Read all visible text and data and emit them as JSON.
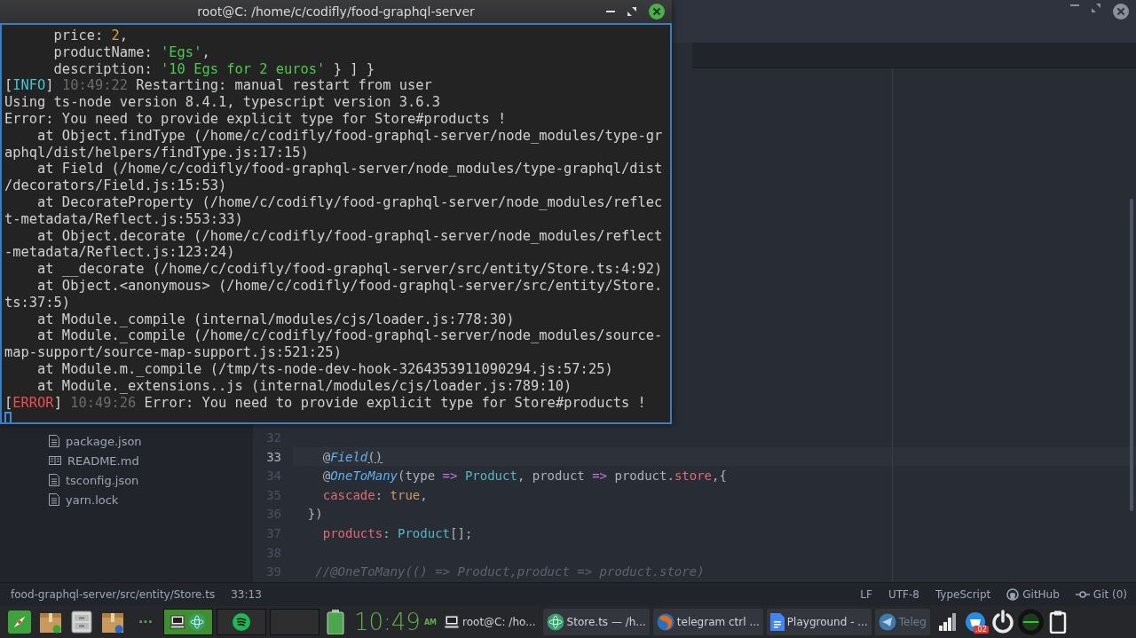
{
  "editor": {
    "sidebar": {
      "files": [
        {
          "name": "package.json",
          "kind": "file"
        },
        {
          "name": "README.md",
          "kind": "book"
        },
        {
          "name": "tsconfig.json",
          "kind": "file"
        },
        {
          "name": "yarn.lock",
          "kind": "file"
        }
      ]
    },
    "code": {
      "lines": [
        {
          "number": "32",
          "selected": false
        },
        {
          "number": "33",
          "selected": true,
          "tokens": [
            {
              "text": "    @",
              "kind": "plain"
            },
            {
              "text": "Field",
              "kind": "decorator"
            },
            {
              "text": "()",
              "kind": "match"
            }
          ]
        },
        {
          "number": "34",
          "selected": false,
          "tokens": [
            {
              "text": "    @",
              "kind": "plain"
            },
            {
              "text": "OneToMany",
              "kind": "decorator"
            },
            {
              "text": "(type ",
              "kind": "plain"
            },
            {
              "text": "=>",
              "kind": "operator"
            },
            {
              "text": " Product",
              "kind": "type"
            },
            {
              "text": ", product ",
              "kind": "plain"
            },
            {
              "text": "=>",
              "kind": "operator"
            },
            {
              "text": " product.",
              "kind": "plain"
            },
            {
              "text": "store",
              "kind": "property"
            },
            {
              "text": ",{",
              "kind": "plain"
            }
          ]
        },
        {
          "number": "35",
          "selected": false,
          "tokens": [
            {
              "text": "    cascade",
              "kind": "property"
            },
            {
              "text": ": ",
              "kind": "plain"
            },
            {
              "text": "true",
              "kind": "value"
            },
            {
              "text": ",",
              "kind": "plain"
            }
          ]
        },
        {
          "number": "36",
          "selected": false,
          "tokens": [
            {
              "text": "  })",
              "kind": "plain"
            }
          ]
        },
        {
          "number": "37",
          "selected": false,
          "tokens": [
            {
              "text": "    products",
              "kind": "property"
            },
            {
              "text": ": ",
              "kind": "plain"
            },
            {
              "text": "Product",
              "kind": "type"
            },
            {
              "text": "[];",
              "kind": "plain"
            }
          ]
        },
        {
          "number": "38",
          "selected": false
        },
        {
          "number": "39",
          "selected": false,
          "tokens": [
            {
              "text": "   //@OneToMany(() => Product,product => product.store)",
              "kind": "comment"
            }
          ]
        }
      ]
    },
    "status_bar": {
      "path": "food-graphql-server/src/entity/Store.ts",
      "position": "33:13",
      "items": [
        {
          "label": "LF",
          "kind": "text"
        },
        {
          "label": "UTF-8",
          "kind": "text"
        },
        {
          "label": "TypeScript",
          "kind": "text"
        },
        {
          "label": "GitHub",
          "kind": "github"
        },
        {
          "label": "Git (0)",
          "kind": "git"
        }
      ]
    }
  },
  "terminal": {
    "title": "root@C: /home/c/codifly/food-graphql-server",
    "lines": [
      [
        {
          "text": "      price: ",
          "kind": "plain"
        },
        {
          "text": "2",
          "kind": "number"
        },
        {
          "text": ",",
          "kind": "plain"
        }
      ],
      [
        {
          "text": "      productName: ",
          "kind": "plain"
        },
        {
          "text": "'Egs'",
          "kind": "string"
        },
        {
          "text": ",",
          "kind": "plain"
        }
      ],
      [
        {
          "text": "      description: ",
          "kind": "plain"
        },
        {
          "text": "'10 Egs for 2 euros'",
          "kind": "string"
        },
        {
          "text": " } ] }",
          "kind": "plain"
        }
      ],
      [
        {
          "text": "[",
          "kind": "plain"
        },
        {
          "text": "INFO",
          "kind": "info"
        },
        {
          "text": "] ",
          "kind": "plain"
        },
        {
          "text": "10:49:22",
          "kind": "time"
        },
        {
          "text": " Restarting: manual restart from user",
          "kind": "plain"
        }
      ],
      [
        {
          "text": "Using ts-node version 8.4.1, typescript version 3.6.3",
          "kind": "plain"
        }
      ],
      [
        {
          "text": "Error: You need to provide explicit type for Store#products !",
          "kind": "plain"
        }
      ],
      [
        {
          "text": "    at Object.findType (/home/c/codifly/food-graphql-server/node_modules/type-gr",
          "kind": "plain"
        }
      ],
      [
        {
          "text": "aphql/dist/helpers/findType.js:17:15)",
          "kind": "plain"
        }
      ],
      [
        {
          "text": "    at Field (/home/c/codifly/food-graphql-server/node_modules/type-graphql/dist",
          "kind": "plain"
        }
      ],
      [
        {
          "text": "/decorators/Field.js:15:53)",
          "kind": "plain"
        }
      ],
      [
        {
          "text": "    at DecorateProperty (/home/c/codifly/food-graphql-server/node_modules/reflec",
          "kind": "plain"
        }
      ],
      [
        {
          "text": "t-metadata/Reflect.js:553:33)",
          "kind": "plain"
        }
      ],
      [
        {
          "text": "    at Object.decorate (/home/c/codifly/food-graphql-server/node_modules/reflect",
          "kind": "plain"
        }
      ],
      [
        {
          "text": "-metadata/Reflect.js:123:24)",
          "kind": "plain"
        }
      ],
      [
        {
          "text": "    at __decorate (/home/c/codifly/food-graphql-server/src/entity/Store.ts:4:92)",
          "kind": "plain"
        }
      ],
      [
        {
          "text": "    at Object.<anonymous> (/home/c/codifly/food-graphql-server/src/entity/Store.",
          "kind": "plain"
        }
      ],
      [
        {
          "text": "ts:37:5)",
          "kind": "plain"
        }
      ],
      [
        {
          "text": "    at Module._compile (internal/modules/cjs/loader.js:778:30)",
          "kind": "plain"
        }
      ],
      [
        {
          "text": "    at Module._compile (/home/c/codifly/food-graphql-server/node_modules/source-",
          "kind": "plain"
        }
      ],
      [
        {
          "text": "map-support/source-map-support.js:521:25)",
          "kind": "plain"
        }
      ],
      [
        {
          "text": "    at Module.m._compile (/tmp/ts-node-dev-hook-3264353911090294.js:57:25)",
          "kind": "plain"
        }
      ],
      [
        {
          "text": "    at Module._extensions..js (internal/modules/cjs/loader.js:789:10)",
          "kind": "plain"
        }
      ],
      [
        {
          "text": "[",
          "kind": "plain"
        },
        {
          "text": "ERROR",
          "kind": "error"
        },
        {
          "text": "] ",
          "kind": "plain"
        },
        {
          "text": "10:49:26",
          "kind": "time"
        },
        {
          "text": " Error: You need to provide explicit type for Store#products !",
          "kind": "plain"
        }
      ]
    ]
  },
  "taskbar": {
    "more": "···",
    "clock": "10:49",
    "meridiem": "AM",
    "tasks": [
      {
        "label": "root@C: /ho...",
        "kind": "computer",
        "minimized": false
      },
      {
        "label": "Store.ts — /h...",
        "kind": "atom",
        "minimized": false
      },
      {
        "label": "telegram ctrl ...",
        "kind": "browser",
        "minimized": false
      },
      {
        "label": "Playground - ...",
        "kind": "document",
        "minimized": false
      },
      {
        "label": "Teleg",
        "kind": "telegram",
        "minimized": true
      }
    ],
    "badge": ".02"
  }
}
